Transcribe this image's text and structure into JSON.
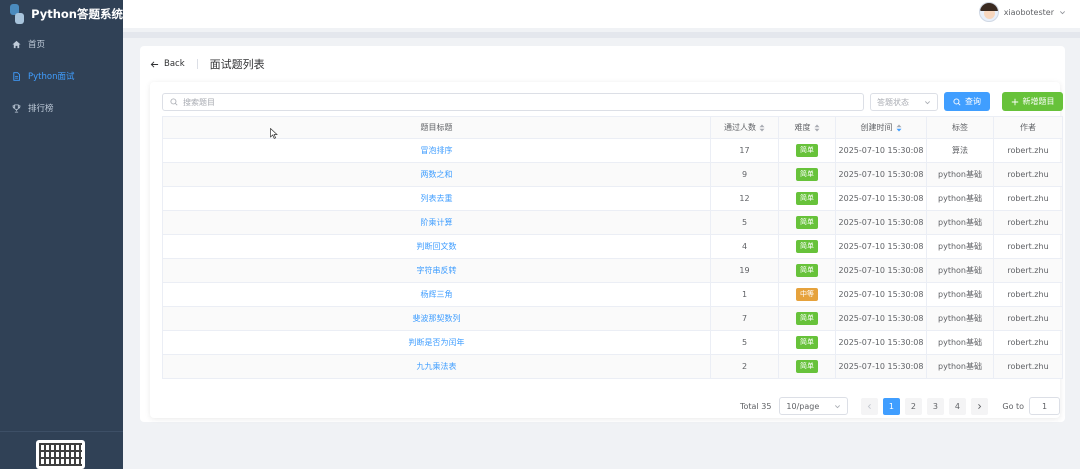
{
  "app": {
    "title": "Python答题系统"
  },
  "sidebar": {
    "items": [
      {
        "label": "首页",
        "icon": "home-icon",
        "active": false
      },
      {
        "label": "Python面试",
        "icon": "document-icon",
        "active": true
      },
      {
        "label": "排行榜",
        "icon": "trophy-icon",
        "active": false
      }
    ]
  },
  "header": {
    "username": "xiaobotester"
  },
  "page": {
    "back_label": "Back",
    "title": "面试题列表"
  },
  "toolbar": {
    "search_placeholder": "搜索题目",
    "status_placeholder": "答题状态",
    "query_label": "查询",
    "add_label": "新增题目"
  },
  "table": {
    "columns": [
      "题目标题",
      "通过人数",
      "难度",
      "创建时间",
      "标签",
      "作者"
    ],
    "rows": [
      {
        "title": "冒泡排序",
        "passed": "17",
        "difficulty": "简单",
        "created": "2025-07-10 15:30:08",
        "tag": "算法",
        "author": "robert.zhu"
      },
      {
        "title": "两数之和",
        "passed": "9",
        "difficulty": "简单",
        "created": "2025-07-10 15:30:08",
        "tag": "python基础",
        "author": "robert.zhu"
      },
      {
        "title": "列表去重",
        "passed": "12",
        "difficulty": "简单",
        "created": "2025-07-10 15:30:08",
        "tag": "python基础",
        "author": "robert.zhu"
      },
      {
        "title": "阶乘计算",
        "passed": "5",
        "difficulty": "简单",
        "created": "2025-07-10 15:30:08",
        "tag": "python基础",
        "author": "robert.zhu"
      },
      {
        "title": "判断回文数",
        "passed": "4",
        "difficulty": "简单",
        "created": "2025-07-10 15:30:08",
        "tag": "python基础",
        "author": "robert.zhu"
      },
      {
        "title": "字符串反转",
        "passed": "19",
        "difficulty": "简单",
        "created": "2025-07-10 15:30:08",
        "tag": "python基础",
        "author": "robert.zhu"
      },
      {
        "title": "杨辉三角",
        "passed": "1",
        "difficulty": "中等",
        "created": "2025-07-10 15:30:08",
        "tag": "python基础",
        "author": "robert.zhu"
      },
      {
        "title": "斐波那契数列",
        "passed": "7",
        "difficulty": "简单",
        "created": "2025-07-10 15:30:08",
        "tag": "python基础",
        "author": "robert.zhu"
      },
      {
        "title": "判断是否为闰年",
        "passed": "5",
        "difficulty": "简单",
        "created": "2025-07-10 15:30:08",
        "tag": "python基础",
        "author": "robert.zhu"
      },
      {
        "title": "九九乘法表",
        "passed": "2",
        "difficulty": "简单",
        "created": "2025-07-10 15:30:08",
        "tag": "python基础",
        "author": "robert.zhu"
      }
    ]
  },
  "difficulty_colors": {
    "简单": "#67c23a",
    "中等": "#e6a23c"
  },
  "pagination": {
    "total_label": "Total 35",
    "page_size": "10/page",
    "pages": [
      "1",
      "2",
      "3",
      "4"
    ],
    "current_page": "1",
    "goto_label": "Go to",
    "goto_value": "1"
  },
  "colors": {
    "sidebar_bg": "#304156",
    "primary": "#409eff",
    "success": "#67c23a",
    "warning": "#e6a23c"
  }
}
